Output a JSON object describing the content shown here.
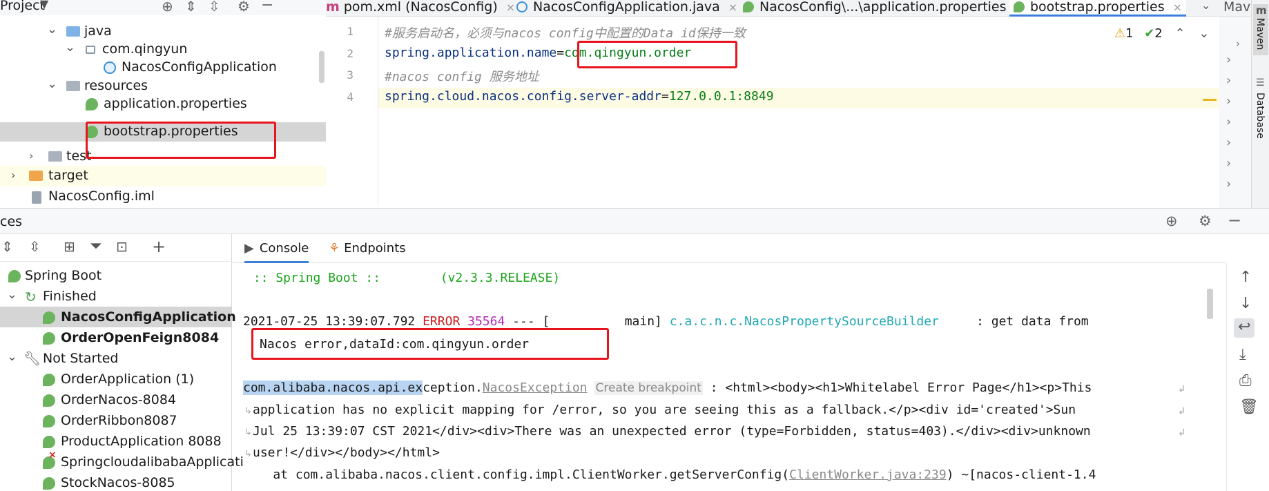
{
  "project_panel": {
    "title": "Project",
    "tree": [
      {
        "label": "java",
        "icon": "folder-icon",
        "expanded": true
      },
      {
        "label": "com.qingyun",
        "icon": "package-icon",
        "expanded": true
      },
      {
        "label": "NacosConfigApplication",
        "icon": "spring-class-icon"
      },
      {
        "label": "resources",
        "icon": "folder-icon",
        "expanded": true
      },
      {
        "label": "application.properties",
        "icon": "spring-leaf-icon"
      },
      {
        "label": "bootstrap.properties",
        "icon": "spring-leaf-icon",
        "selected": true
      },
      {
        "label": "test",
        "icon": "folder-icon",
        "expanded": false
      },
      {
        "label": "target",
        "icon": "folder-icon",
        "expanded": false
      },
      {
        "label": "NacosConfig.iml",
        "icon": "module-file-icon"
      }
    ]
  },
  "editor_tabs": [
    {
      "label": "pom.xml (NacosConfig)",
      "icon": "maven-icon"
    },
    {
      "label": "NacosConfigApplication.java",
      "icon": "java-class-icon"
    },
    {
      "label": "NacosConfig\\...\\application.properties",
      "icon": "spring-leaf-icon"
    },
    {
      "label": "bootstrap.properties",
      "icon": "spring-leaf-icon",
      "active": true
    },
    {
      "label": "Mav",
      "icon": "maven-tool-window"
    }
  ],
  "editor": {
    "line_numbers": [
      "1",
      "2",
      "3",
      "4"
    ],
    "line1_comment": "#服务启动名，必须与nacos config中配置的Data id保持一致",
    "line2_key": "spring.application.name",
    "line2_eq": "=",
    "line2_value": "com.qingyun.order",
    "line3_comment": "#nacos config 服务地址",
    "line4_key": "spring.cloud.nacos.config.server-addr",
    "line4_eq": "=",
    "line4_value": "127.0.0.1:8849",
    "warnings": "1",
    "checks": "2"
  },
  "side_tools": {
    "maven": "Maven",
    "database": "Database"
  },
  "services_panel": {
    "title": "ces",
    "tree": [
      {
        "label": "Spring Boot"
      },
      {
        "label": "Finished"
      },
      {
        "label": "NacosConfigApplication",
        "bold": true,
        "selected": true
      },
      {
        "label": "OrderOpenFeign8084",
        "bold": true
      },
      {
        "label": "Not Started"
      },
      {
        "label": "OrderApplication (1)"
      },
      {
        "label": "OrderNacos-8084"
      },
      {
        "label": "OrderRibbon8087"
      },
      {
        "label": "ProductApplication 8088"
      },
      {
        "label": "SpringcloudalibabaApplicati"
      },
      {
        "label": "StockNacos-8085"
      }
    ]
  },
  "console": {
    "tabs": [
      {
        "label": "Console",
        "active": true
      },
      {
        "label": "Endpoints"
      }
    ],
    "banner": " :: Spring Boot ::        (v2.3.3.RELEASE)",
    "log_time": "2021-07-25 13:39:07.792",
    "log_level": "ERROR",
    "log_pid": "35564",
    "log_sep": "--- [          main]",
    "log_logger": "c.a.c.n.c.NacosPropertySourceBuilder",
    "log_msg": "     : get data from",
    "log_cont": "Nacos error,dataId:com.qingyun.order",
    "exc_pkg": "com.alibaba.nacos.api.ex",
    "exc_pkg_rest": "ception.",
    "exc_class": "NacosException",
    "exc_hint": "Create breakpoint",
    "exc_msg1": " : <html><body><h1>Whitelabel Error Page</h1><p>This",
    "exc_msg2": "application has no explicit mapping for /error, so you are seeing this as a fallback.</p><div id='created'>Sun",
    "exc_msg3": "Jul 25 13:39:07 CST 2021</div><div>There was an unexpected error (type=Forbidden, status=403).</div><div>unknown",
    "exc_msg4": "user!</div></body></html>",
    "stack_pre": "    at com.alibaba.nacos.client.config.impl.ClientWorker.getServerConfig(",
    "stack_link": "ClientWorker.java:239",
    "stack_post": ") ~[nacos-client-1.4"
  }
}
